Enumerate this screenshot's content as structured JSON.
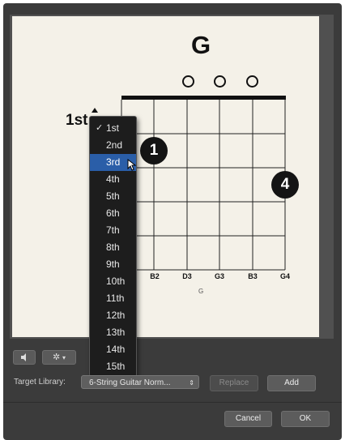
{
  "chord": {
    "name": "G",
    "fret_position": "1st",
    "caption": "G",
    "strings": [
      "",
      "B2",
      "D3",
      "G3",
      "B3",
      "G4"
    ],
    "open_strings": 3,
    "fingers": [
      {
        "label": "1",
        "string": 2,
        "fret": 2
      },
      {
        "label": "4",
        "string": 6,
        "fret": 3
      }
    ]
  },
  "fret_menu": {
    "items": [
      "1st",
      "2nd",
      "3rd",
      "4th",
      "5th",
      "6th",
      "7th",
      "8th",
      "9th",
      "10th",
      "11th",
      "12th",
      "13th",
      "14th",
      "15th"
    ],
    "checked": "1st",
    "highlighted": "3rd",
    "check_mark": "✓"
  },
  "toolbar": {
    "speaker_icon": "speaker-icon",
    "gear_icon": "gear-icon",
    "gear_chevron": "▾"
  },
  "target": {
    "label": "Target Library:",
    "value": "6-String Guitar Norm...",
    "arrows": "⇕",
    "replace_label": "Replace",
    "add_label": "Add"
  },
  "footer": {
    "cancel_label": "Cancel",
    "ok_label": "OK"
  },
  "colors": {
    "window_bg": "#3b3b3b",
    "canvas_bg": "#f4f1e8",
    "menu_bg": "#1d1d1d",
    "highlight": "#2a5ea8"
  }
}
